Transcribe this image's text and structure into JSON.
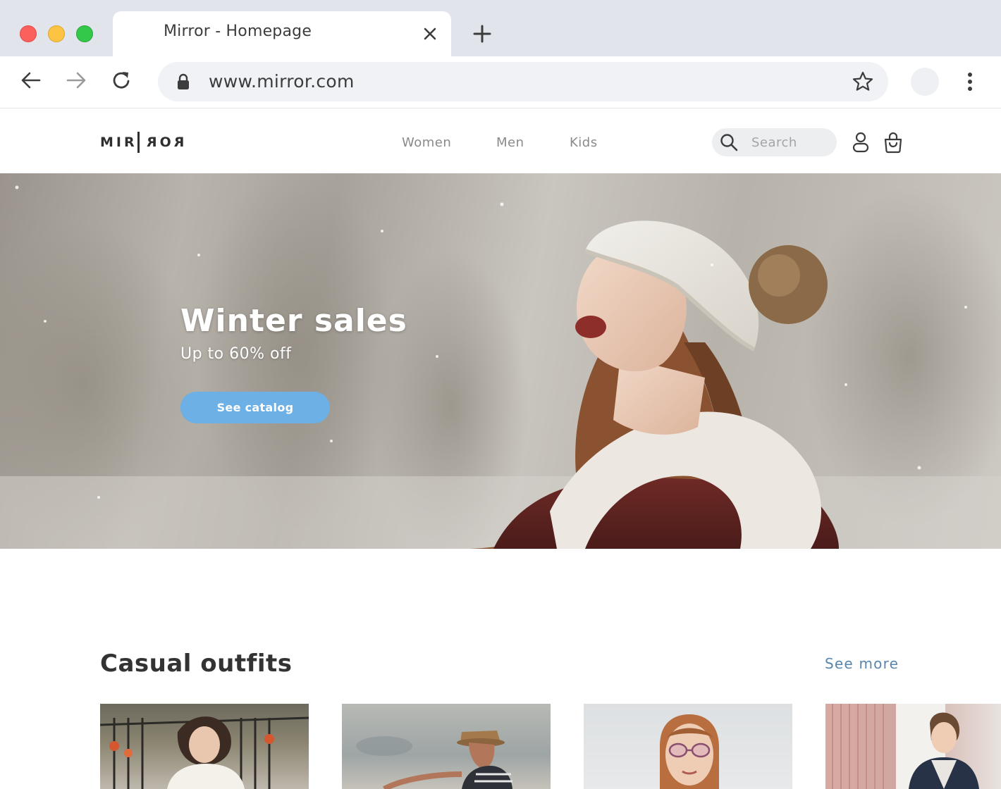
{
  "browser": {
    "tab_title": "Mirror - Homepage",
    "url": "www.mirror.com",
    "icons": {
      "close": "close-icon",
      "new_tab": "plus-icon",
      "back": "arrow-left-icon",
      "forward": "arrow-right-icon",
      "reload": "reload-icon",
      "lock": "lock-icon",
      "bookmark": "star-icon",
      "menu": "kebab-menu-icon"
    }
  },
  "site": {
    "logo_left": "MIR",
    "logo_right": "ROR",
    "nav": [
      "Women",
      "Men",
      "Kids"
    ],
    "search_placeholder": "Search",
    "icons": {
      "search": "search-icon",
      "account": "user-icon",
      "cart": "shopping-bag-icon"
    }
  },
  "hero": {
    "title": "Winter sales",
    "subtitle": "Up to 60% off",
    "cta_label": "See catalog"
  },
  "section": {
    "title": "Casual outfits",
    "see_more": "See more"
  },
  "colors": {
    "accent": "#6cb0e6",
    "link": "#5a86ad",
    "chrome_bg": "#e1e4eb",
    "omnibox_bg": "#f0f2f5"
  }
}
